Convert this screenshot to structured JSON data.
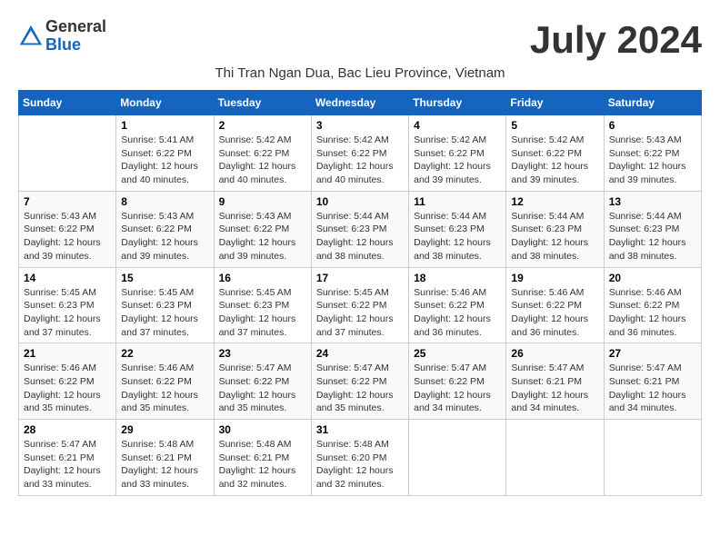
{
  "header": {
    "logo_general": "General",
    "logo_blue": "Blue",
    "month_title": "July 2024",
    "subtitle": "Thi Tran Ngan Dua, Bac Lieu Province, Vietnam"
  },
  "weekdays": [
    "Sunday",
    "Monday",
    "Tuesday",
    "Wednesday",
    "Thursday",
    "Friday",
    "Saturday"
  ],
  "weeks": [
    [
      {
        "day": "",
        "info": ""
      },
      {
        "day": "1",
        "info": "Sunrise: 5:41 AM\nSunset: 6:22 PM\nDaylight: 12 hours\nand 40 minutes."
      },
      {
        "day": "2",
        "info": "Sunrise: 5:42 AM\nSunset: 6:22 PM\nDaylight: 12 hours\nand 40 minutes."
      },
      {
        "day": "3",
        "info": "Sunrise: 5:42 AM\nSunset: 6:22 PM\nDaylight: 12 hours\nand 40 minutes."
      },
      {
        "day": "4",
        "info": "Sunrise: 5:42 AM\nSunset: 6:22 PM\nDaylight: 12 hours\nand 39 minutes."
      },
      {
        "day": "5",
        "info": "Sunrise: 5:42 AM\nSunset: 6:22 PM\nDaylight: 12 hours\nand 39 minutes."
      },
      {
        "day": "6",
        "info": "Sunrise: 5:43 AM\nSunset: 6:22 PM\nDaylight: 12 hours\nand 39 minutes."
      }
    ],
    [
      {
        "day": "7",
        "info": "Sunrise: 5:43 AM\nSunset: 6:22 PM\nDaylight: 12 hours\nand 39 minutes."
      },
      {
        "day": "8",
        "info": "Sunrise: 5:43 AM\nSunset: 6:22 PM\nDaylight: 12 hours\nand 39 minutes."
      },
      {
        "day": "9",
        "info": "Sunrise: 5:43 AM\nSunset: 6:22 PM\nDaylight: 12 hours\nand 39 minutes."
      },
      {
        "day": "10",
        "info": "Sunrise: 5:44 AM\nSunset: 6:23 PM\nDaylight: 12 hours\nand 38 minutes."
      },
      {
        "day": "11",
        "info": "Sunrise: 5:44 AM\nSunset: 6:23 PM\nDaylight: 12 hours\nand 38 minutes."
      },
      {
        "day": "12",
        "info": "Sunrise: 5:44 AM\nSunset: 6:23 PM\nDaylight: 12 hours\nand 38 minutes."
      },
      {
        "day": "13",
        "info": "Sunrise: 5:44 AM\nSunset: 6:23 PM\nDaylight: 12 hours\nand 38 minutes."
      }
    ],
    [
      {
        "day": "14",
        "info": "Sunrise: 5:45 AM\nSunset: 6:23 PM\nDaylight: 12 hours\nand 37 minutes."
      },
      {
        "day": "15",
        "info": "Sunrise: 5:45 AM\nSunset: 6:23 PM\nDaylight: 12 hours\nand 37 minutes."
      },
      {
        "day": "16",
        "info": "Sunrise: 5:45 AM\nSunset: 6:23 PM\nDaylight: 12 hours\nand 37 minutes."
      },
      {
        "day": "17",
        "info": "Sunrise: 5:45 AM\nSunset: 6:22 PM\nDaylight: 12 hours\nand 37 minutes."
      },
      {
        "day": "18",
        "info": "Sunrise: 5:46 AM\nSunset: 6:22 PM\nDaylight: 12 hours\nand 36 minutes."
      },
      {
        "day": "19",
        "info": "Sunrise: 5:46 AM\nSunset: 6:22 PM\nDaylight: 12 hours\nand 36 minutes."
      },
      {
        "day": "20",
        "info": "Sunrise: 5:46 AM\nSunset: 6:22 PM\nDaylight: 12 hours\nand 36 minutes."
      }
    ],
    [
      {
        "day": "21",
        "info": "Sunrise: 5:46 AM\nSunset: 6:22 PM\nDaylight: 12 hours\nand 35 minutes."
      },
      {
        "day": "22",
        "info": "Sunrise: 5:46 AM\nSunset: 6:22 PM\nDaylight: 12 hours\nand 35 minutes."
      },
      {
        "day": "23",
        "info": "Sunrise: 5:47 AM\nSunset: 6:22 PM\nDaylight: 12 hours\nand 35 minutes."
      },
      {
        "day": "24",
        "info": "Sunrise: 5:47 AM\nSunset: 6:22 PM\nDaylight: 12 hours\nand 35 minutes."
      },
      {
        "day": "25",
        "info": "Sunrise: 5:47 AM\nSunset: 6:22 PM\nDaylight: 12 hours\nand 34 minutes."
      },
      {
        "day": "26",
        "info": "Sunrise: 5:47 AM\nSunset: 6:21 PM\nDaylight: 12 hours\nand 34 minutes."
      },
      {
        "day": "27",
        "info": "Sunrise: 5:47 AM\nSunset: 6:21 PM\nDaylight: 12 hours\nand 34 minutes."
      }
    ],
    [
      {
        "day": "28",
        "info": "Sunrise: 5:47 AM\nSunset: 6:21 PM\nDaylight: 12 hours\nand 33 minutes."
      },
      {
        "day": "29",
        "info": "Sunrise: 5:48 AM\nSunset: 6:21 PM\nDaylight: 12 hours\nand 33 minutes."
      },
      {
        "day": "30",
        "info": "Sunrise: 5:48 AM\nSunset: 6:21 PM\nDaylight: 12 hours\nand 32 minutes."
      },
      {
        "day": "31",
        "info": "Sunrise: 5:48 AM\nSunset: 6:20 PM\nDaylight: 12 hours\nand 32 minutes."
      },
      {
        "day": "",
        "info": ""
      },
      {
        "day": "",
        "info": ""
      },
      {
        "day": "",
        "info": ""
      }
    ]
  ]
}
